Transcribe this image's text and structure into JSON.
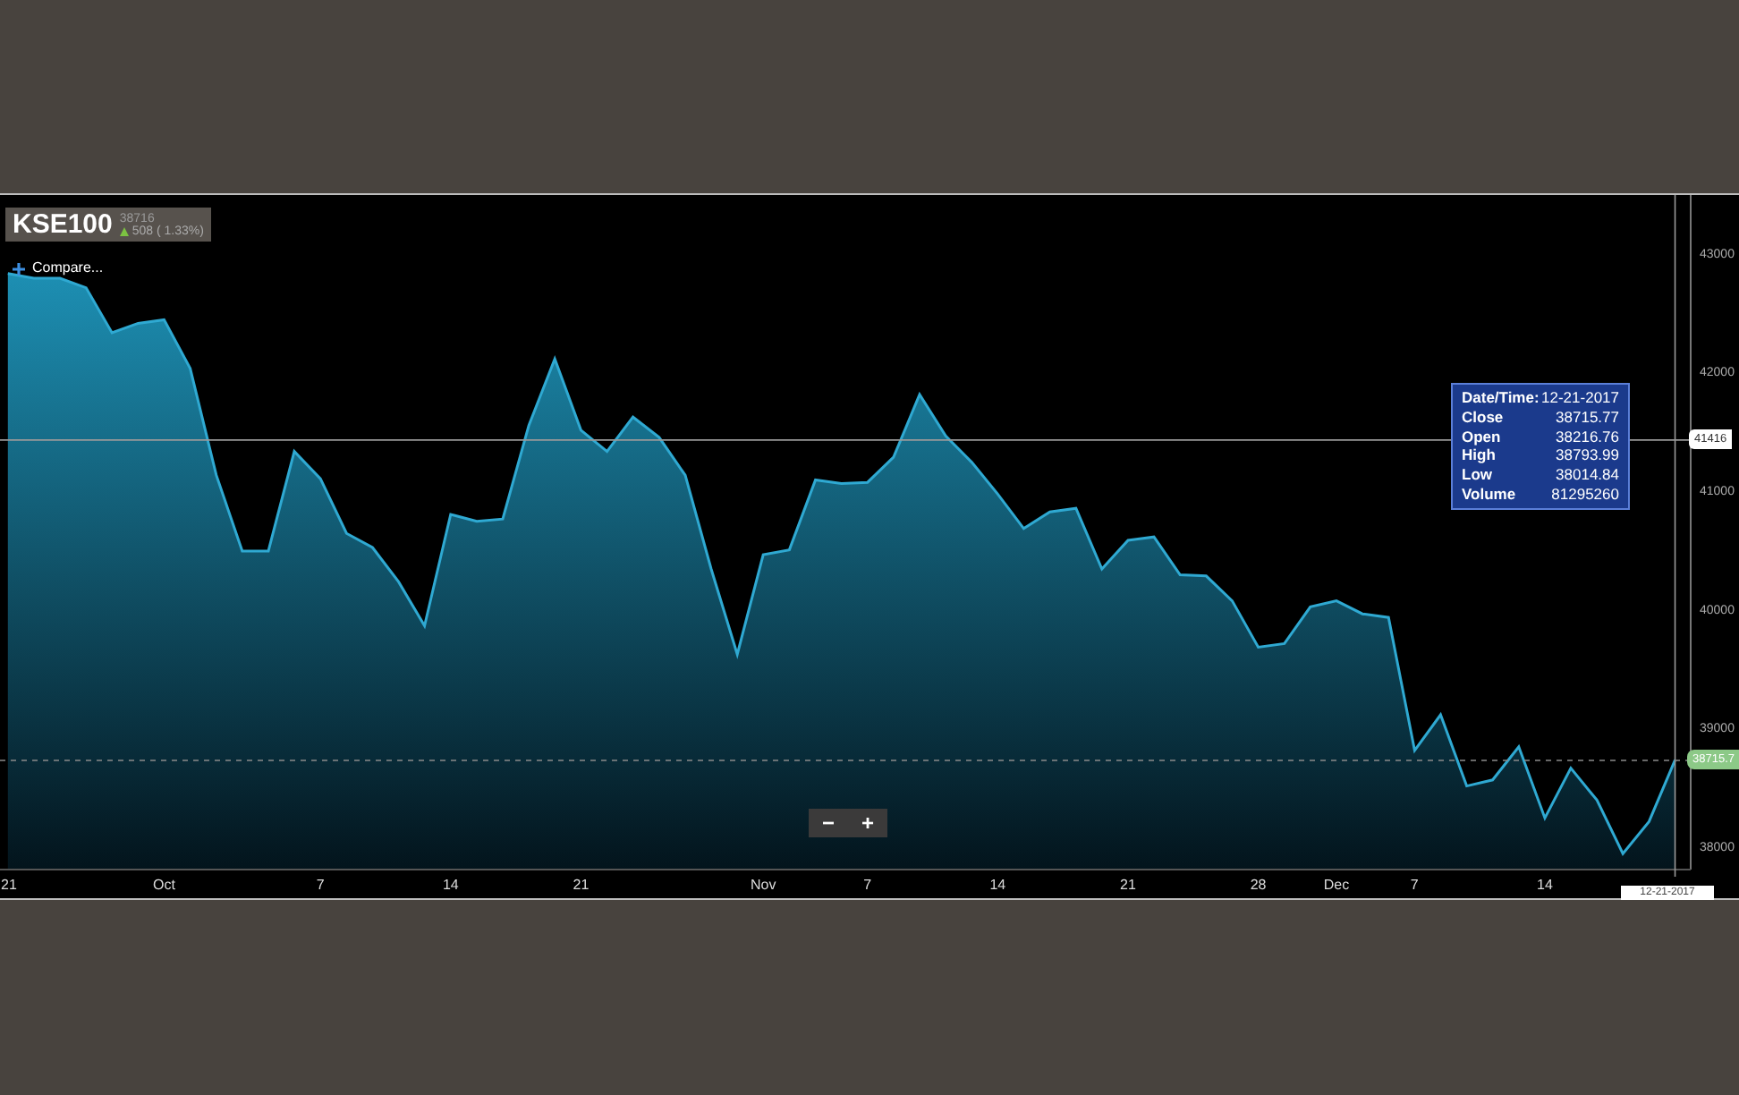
{
  "chart": {
    "symbol": "KSE100",
    "last": "38716",
    "rising": true,
    "change": "508 ( 1.33%)",
    "compare": "Compare...",
    "tooltip": [
      {
        "label": "Date/Time:",
        "value": "12-21-2017"
      },
      {
        "label": "Close",
        "value": "38715.77"
      },
      {
        "label": "Open",
        "value": "38216.76"
      },
      {
        "label": "High",
        "value": "38793.99"
      },
      {
        "label": "Low",
        "value": "38014.84"
      },
      {
        "label": "Volume",
        "value": "81295260"
      }
    ],
    "crosshair_price": "41416",
    "crosshair_date": "12-21-2017",
    "zoom_buttons": [
      "−",
      "+"
    ],
    "chart_data": {
      "type": "area",
      "categories": [
        "21",
        null,
        null,
        null,
        null,
        null,
        "Oct",
        null,
        null,
        null,
        null,
        null,
        "7",
        null,
        null,
        null,
        null,
        "14",
        null,
        null,
        null,
        null,
        "21",
        null,
        null,
        null,
        null,
        null,
        null,
        "Nov",
        null,
        null,
        null,
        "7",
        null,
        null,
        null,
        null,
        "14",
        null,
        null,
        null,
        null,
        "21",
        null,
        null,
        null,
        null,
        "28",
        null,
        null,
        "Dec",
        null,
        null,
        "7",
        null,
        null,
        null,
        null,
        "14",
        null,
        null,
        null,
        null,
        null
      ],
      "ylim": [
        37795,
        43482
      ],
      "ref_lines": [
        {
          "axis": "y",
          "value": 38715.7,
          "label": "38715.7"
        }
      ],
      "yticks": [
        38000,
        39000,
        40000,
        41000,
        42000,
        43000
      ],
      "series": [
        {
          "color": "#2fa9d2",
          "values": [
            42820,
            42780,
            42780,
            42700,
            42320,
            42400,
            42430,
            42020,
            41120,
            40480,
            40480,
            41320,
            41090,
            40630,
            40510,
            40220,
            39850,
            40790,
            40730,
            40750,
            41540,
            42100,
            41500,
            41320,
            41610,
            41440,
            41120,
            40330,
            39610,
            40450,
            40490,
            41080,
            41050,
            41060,
            41270,
            41800,
            41450,
            41230,
            40960,
            40670,
            40810,
            40840,
            40330,
            40570,
            40600,
            40280,
            40270,
            40060,
            39670,
            39700,
            40010,
            40060,
            39950,
            39920,
            38800,
            39100,
            38500,
            38550,
            38830,
            38230,
            38650,
            38380,
            37930,
            38200,
            38720
          ]
        }
      ]
    }
  }
}
